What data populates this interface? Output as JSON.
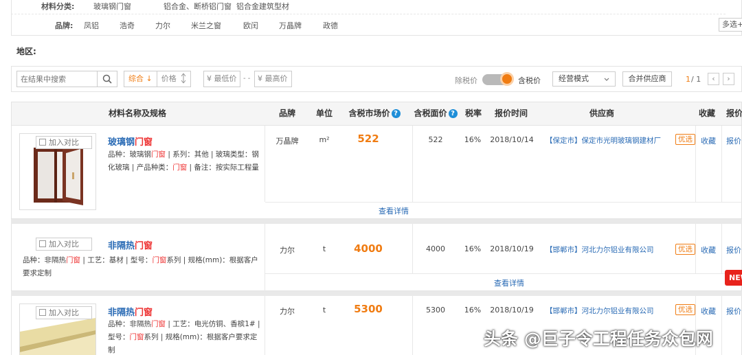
{
  "filters": {
    "category_label": "材料分类:",
    "categories": [
      "玻璃钢门窗",
      "铝合金、断桥铝门窗",
      "铝合金建筑型材"
    ],
    "brand_label": "品牌:",
    "brands": [
      "凤铝",
      "浩奇",
      "力尔",
      "米兰之窗",
      "欧闰",
      "万晶牌",
      "政德"
    ],
    "multi_select": "多选+",
    "region_label": "地区:"
  },
  "toolbar": {
    "search_placeholder": "在结果中搜索",
    "sort_composite": "综合 ↓",
    "sort_price": "价格",
    "min_price": "¥ 最低价",
    "range_sep": "- -",
    "max_price": "¥ 最高价",
    "excl_tax": "除税价",
    "incl_tax": "含税价",
    "tax_toggle_on": true,
    "mode_select": "经营模式",
    "merge_suppliers": "合并供应商",
    "page_current": "1",
    "page_total": "/ 1",
    "prev": "‹",
    "next": "›"
  },
  "colors": {
    "accent": "#f07c12",
    "link": "#2a6bb5",
    "highlight": "#e33333",
    "new_badge": "#e8231c"
  },
  "table": {
    "headers": {
      "name": "材料名称及规格",
      "brand": "品牌",
      "unit": "单位",
      "market_price": "含税市场价",
      "face_price": "含税面价",
      "tax_rate": "税率",
      "quote_time": "报价时间",
      "supplier": "供应商",
      "favorite": "收藏",
      "quote": "报价"
    },
    "compare_label": "加入对比",
    "detail_label": "查看详情",
    "preferred_label": "优选",
    "favorite_label": "收藏",
    "quote_label": "报价",
    "new_label": "NEW",
    "rows": [
      {
        "name_prefix": "玻璃钢",
        "name_hl": "门窗",
        "desc": [
          {
            "t": "品种：玻璃钢",
            "h": false
          },
          {
            "t": "门窗",
            "h": true
          },
          {
            "t": " | 系列：其他 | 玻璃类型：钢化玻璃 | 产品种类：",
            "h": false
          },
          {
            "t": "门窗",
            "h": true
          },
          {
            "t": " | 备注：按实际工程量",
            "h": false
          }
        ],
        "brand": "万晶牌",
        "unit": "m²",
        "market_price": "522",
        "face_price": "522",
        "tax_rate": "16%",
        "quote_time": "2018/10/14",
        "supplier": "【保定市】保定市光明玻璃钢建材厂"
      },
      {
        "name_prefix": "非隔热",
        "name_hl": "门窗",
        "desc": [
          {
            "t": "品种：非隔热",
            "h": false
          },
          {
            "t": "门窗",
            "h": true
          },
          {
            "t": " | 工艺：基材 | 型号：",
            "h": false
          },
          {
            "t": "门窗",
            "h": true
          },
          {
            "t": "系列 | 规格(mm)：根据客户要求定制",
            "h": false
          }
        ],
        "brand": "力尔",
        "unit": "t",
        "market_price": "4000",
        "face_price": "4000",
        "tax_rate": "16%",
        "quote_time": "2018/10/19",
        "supplier": "【邯郸市】河北力尔铝业有限公司"
      },
      {
        "name_prefix": "非隔热",
        "name_hl": "门窗",
        "desc": [
          {
            "t": "品种：非隔热",
            "h": false
          },
          {
            "t": "门窗",
            "h": true
          },
          {
            "t": " | 工艺：电光仿铜、香槟1# | 型号：",
            "h": false
          },
          {
            "t": "门窗",
            "h": true
          },
          {
            "t": "系列 | 规格(mm)：根据客户要求定制",
            "h": false
          }
        ],
        "brand": "力尔",
        "unit": "t",
        "market_price": "5300",
        "face_price": "5300",
        "tax_rate": "16%",
        "quote_time": "2018/10/19",
        "supplier": "【邯郸市】河北力尔铝业有限公司"
      }
    ]
  },
  "watermark": "头条 @巨子令工程任务众包网"
}
